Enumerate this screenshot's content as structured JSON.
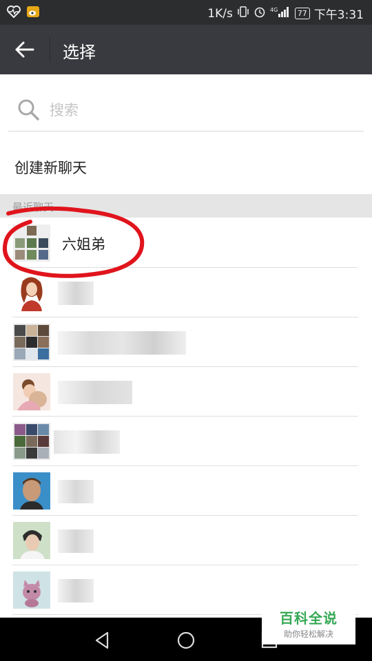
{
  "status_bar": {
    "network_speed": "1K/s",
    "battery": "77",
    "time": "下午3:31",
    "signal_label": "4G"
  },
  "app_bar": {
    "title": "选择"
  },
  "search": {
    "placeholder": "搜索",
    "value": ""
  },
  "create_chat": {
    "label": "创建新聊天"
  },
  "section": {
    "label": "最近聊天"
  },
  "chats": [
    {
      "name": "六姐弟",
      "avatar": "group-avatar-grid"
    },
    {
      "name": "",
      "avatar": "illustrated-woman-avatar"
    },
    {
      "name": "",
      "avatar": "group-avatar-grid"
    },
    {
      "name": "",
      "avatar": "girl-with-bear-avatar"
    },
    {
      "name": "",
      "avatar": "group-avatar-grid"
    },
    {
      "name": "",
      "avatar": "man-portrait-avatar"
    },
    {
      "name": "",
      "avatar": "boy-portrait-avatar"
    },
    {
      "name": "",
      "avatar": "cartoon-cat-avatar"
    }
  ],
  "watermark": {
    "main": "百科全说",
    "sub": "助你轻松解决"
  },
  "colors": {
    "app_bar": "#393a3f",
    "status_bar": "#2b2d2f",
    "annotation": "#e0141c",
    "watermark_green": "#35a853"
  }
}
